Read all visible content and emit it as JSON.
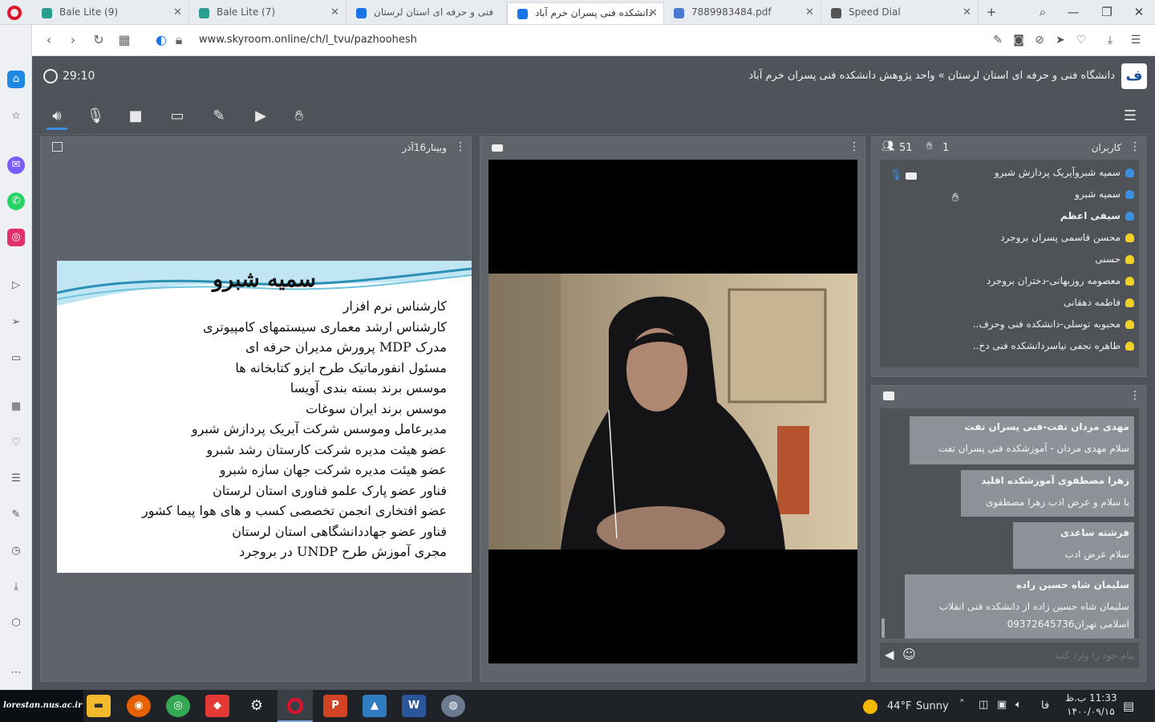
{
  "browser": {
    "tabs": [
      {
        "label": "Bale Lite (9)",
        "color": "#2a9d8f"
      },
      {
        "label": "Bale Lite (7)",
        "color": "#2a9d8f"
      },
      {
        "label": "فنی و حرفه ای استان لرستان",
        "color": "#1a73e8"
      },
      {
        "label": "دانشکده فنی پسران خرم آباد",
        "color": "#1a73e8"
      },
      {
        "label": "7889983484.pdf",
        "color": "#4a7bd0"
      },
      {
        "label": "Speed Dial",
        "color": "#555555"
      }
    ],
    "url": "www.skyroom.online/ch/l_tvu/pazhoohesh"
  },
  "header": {
    "timer": "29:10",
    "breadcrumb": "دانشگاه فنی و حرفه ای استان لرستان » واحد پژوهش دانشکده فنی پسران خرم آباد"
  },
  "slide_panel": {
    "title": "وبینار16آذر",
    "slide": {
      "heading": "سمیه شبرو",
      "lines": [
        "کارشناس نرم افزار",
        "کارشناس ارشد معماری سیستمهای کامپیوتری",
        "مدرک MDP پرورش مدیران حرفه ای",
        "مسئول انفورماتیک طرح ایزو کتابخانه ها",
        "موسس برند بسته بندی آویسا",
        "موسس برند ایران سوغات",
        "مدیرعامل وموسس شرکت آیریک پردازش شبرو",
        "عضو هیئت مدیره شرکت کارستان رشد شبرو",
        "عضو هیئت مدیره شرکت جهان سازه شبرو",
        "فناور عضو پارک علمو فناوری استان لرستان",
        "عضو افتخاری انجمن تخصصی کسب و های هوا پیما کشور",
        "فناور عضو جهاددانشگاهی استان لرستان",
        "مجری آموزش طرح UNDP در بروجرد"
      ]
    }
  },
  "users_panel": {
    "title": "کاربران",
    "user_count": "51",
    "raised_hands": "1",
    "users": [
      {
        "name": "سمیه شبروآیریک پردازش شبرو",
        "role_color": "#3b8fe0"
      },
      {
        "name": "سمیه شبرو",
        "role_color": "#3b8fe0"
      },
      {
        "name": "سیفی اعظم",
        "role_color": "#3b8fe0"
      },
      {
        "name": "محسن قاسمی پسران بروجرد",
        "role_color": "#f2d024"
      },
      {
        "name": "حسنی",
        "role_color": "#f2d024"
      },
      {
        "name": "معصومه روزبهانی-دختران بروجرد",
        "role_color": "#f2d024"
      },
      {
        "name": "فاطمه دهقانی",
        "role_color": "#f2d024"
      },
      {
        "name": "محبوبه توسلی-دانشکده فنی وحرف..",
        "role_color": "#f2d024"
      },
      {
        "name": "طاهره نجفی نیاسردانشکده فنی دخ..",
        "role_color": "#f2d024"
      }
    ]
  },
  "chat_panel": {
    "messages": [
      {
        "sender": "مهدی مردان تفت-فنی پسران تفت",
        "text": "سلام مهدی مردان - آموزشکده فنی پسران تفت"
      },
      {
        "sender": "زهرا مصطفوی آموزشکده اقلید",
        "text": "با سلام و عرض ادب زهرا مصطفوی"
      },
      {
        "sender": "فرشته ساعدی",
        "text": "سلام عرض ادب"
      },
      {
        "sender": "سلیمان شاه حسین زاده",
        "text": "سلیمان شاه حسین زاده از دانشکده فنی انقلاب اسلامی تهران09372645736"
      }
    ],
    "input_placeholder": "پیام خود را وارد کنید"
  },
  "taskbar": {
    "watermark": "lorestan.nus.ac.ir",
    "weather_temp": "44°F",
    "weather_text": "Sunny",
    "lang": "فا",
    "time": "11:33 ب.ظ",
    "date": "۱۴۰۰/۰۹/۱۵"
  }
}
